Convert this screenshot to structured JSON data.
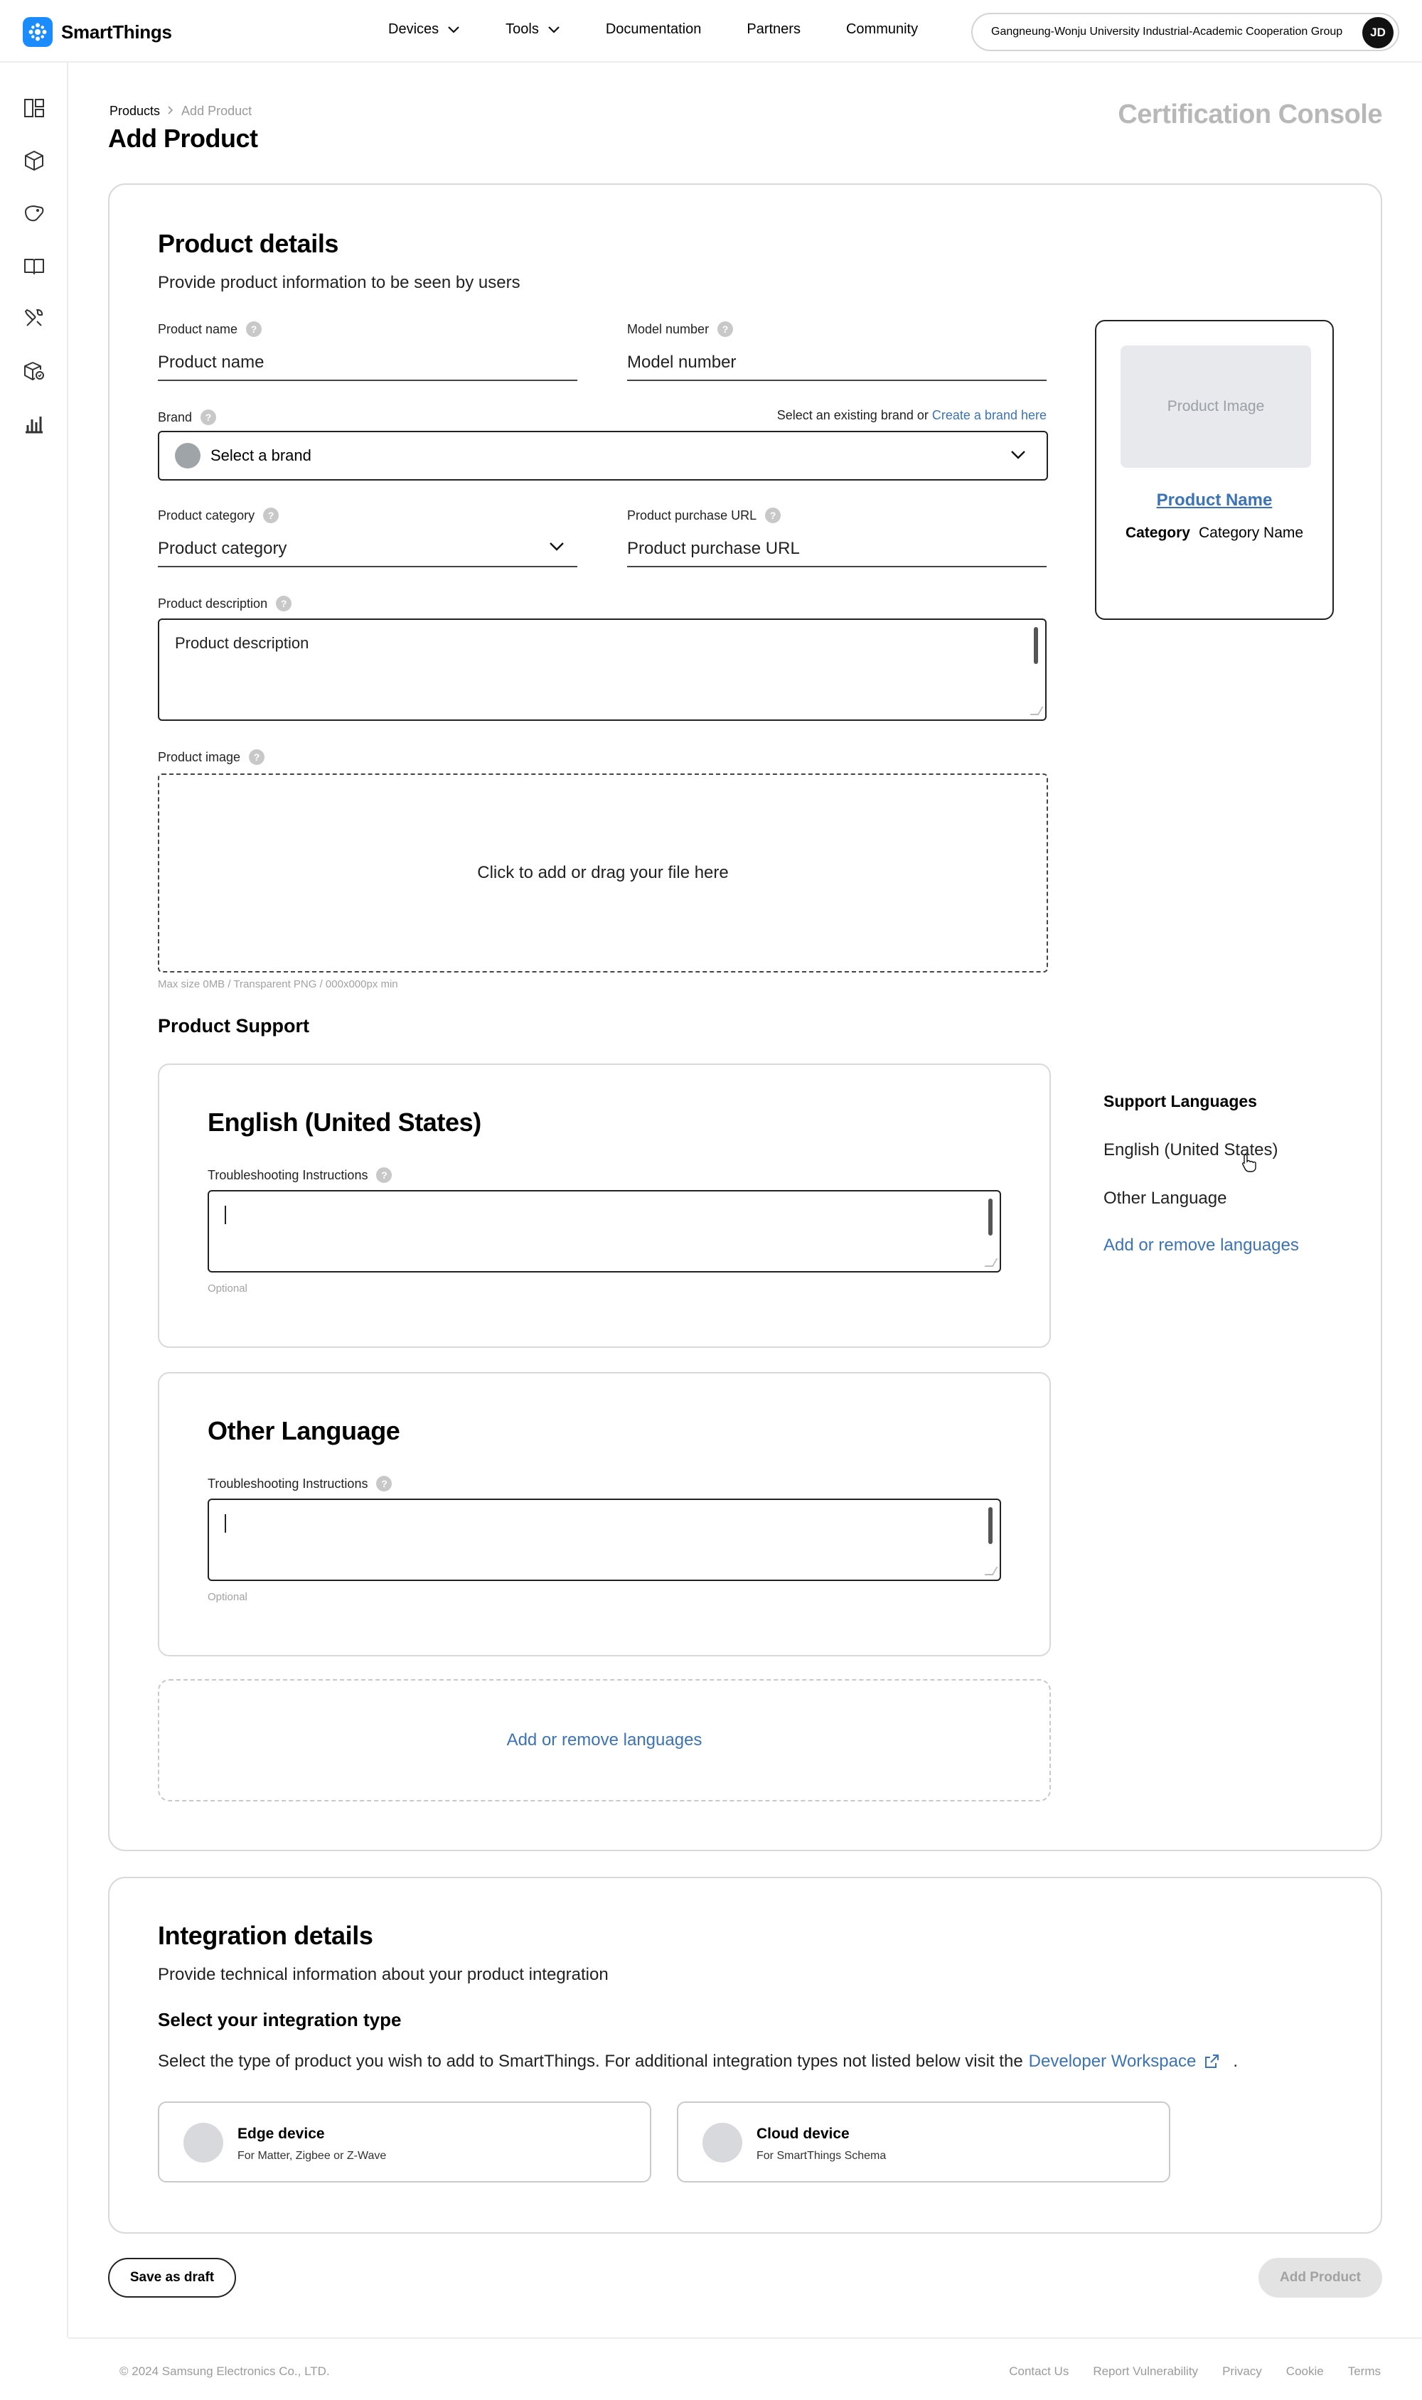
{
  "app": {
    "name": "SmartThings"
  },
  "nav": {
    "items": [
      {
        "label": "Devices",
        "has_dropdown": true
      },
      {
        "label": "Tools",
        "has_dropdown": true
      },
      {
        "label": "Documentation",
        "has_dropdown": false
      },
      {
        "label": "Partners",
        "has_dropdown": false
      },
      {
        "label": "Community",
        "has_dropdown": false
      }
    ]
  },
  "org": {
    "name": "Gangneung-Wonju University Industrial-Academic Cooperation Group",
    "avatar_initials": "JD"
  },
  "rail": {
    "icons": [
      "dashboard-icon",
      "cube-icon",
      "tag-icon",
      "book-icon",
      "tools-icon",
      "certified-box-icon",
      "analytics-icon"
    ]
  },
  "breadcrumb": {
    "parent": "Products",
    "current": "Add Product"
  },
  "page": {
    "title": "Add Product",
    "console_label": "Certification Console"
  },
  "product_details": {
    "title": "Product details",
    "subtitle": "Provide product information to be seen by users",
    "product_name": {
      "label": "Product name",
      "placeholder": "Product name"
    },
    "model_number": {
      "label": "Model number",
      "placeholder": "Model number"
    },
    "brand": {
      "label": "Brand",
      "hint": "Select an existing brand or",
      "hint_link": "Create a brand here",
      "placeholder": "Select a brand"
    },
    "category": {
      "label": "Product category",
      "placeholder": "Product category"
    },
    "purchase_url": {
      "label": "Product purchase URL",
      "placeholder": "Product purchase URL"
    },
    "description": {
      "label": "Product description",
      "placeholder": "Product description"
    },
    "image": {
      "label": "Product image",
      "drop_text": "Click to add or drag your file here",
      "note": "Max size 0MB / Transparent PNG / 000x000px min"
    }
  },
  "preview": {
    "image_placeholder": "Product Image",
    "name": "Product Name",
    "category_label": "Category",
    "category_value": "Category Name"
  },
  "support": {
    "title": "Product Support",
    "languages": [
      {
        "name": "English (United States)",
        "field_label": "Troubleshooting Instructions",
        "optional": "Optional"
      },
      {
        "name": "Other Language",
        "field_label": "Troubleshooting Instructions",
        "optional": "Optional"
      }
    ],
    "add_remove": "Add or remove languages",
    "side_title": "Support Languages",
    "side_items": [
      "English (United States)",
      "Other Language"
    ],
    "side_link": "Add or remove languages"
  },
  "integration": {
    "title": "Integration details",
    "subtitle": "Provide technical information about your product integration",
    "type_heading": "Select your integration type",
    "type_desc": "Select the type of product you wish to add to SmartThings. For additional integration types not listed below visit the",
    "type_link": "Developer Workspace",
    "type_end": ".",
    "options": [
      {
        "name": "Edge device",
        "sub": "For Matter, Zigbee or Z-Wave"
      },
      {
        "name": "Cloud device",
        "sub": "For SmartThings Schema"
      }
    ]
  },
  "actions": {
    "save_draft": "Save as draft",
    "add_product": "Add Product"
  },
  "footer": {
    "copyright": "© 2024 Samsung Electronics Co., LTD.",
    "links": [
      "Contact Us",
      "Report Vulnerability",
      "Privacy",
      "Cookie",
      "Terms"
    ]
  },
  "colors": {
    "brand_blue": "#1a8cff",
    "link_blue": "#3b73b8",
    "muted": "#a2a2a2",
    "border": "#d9d9d9"
  }
}
